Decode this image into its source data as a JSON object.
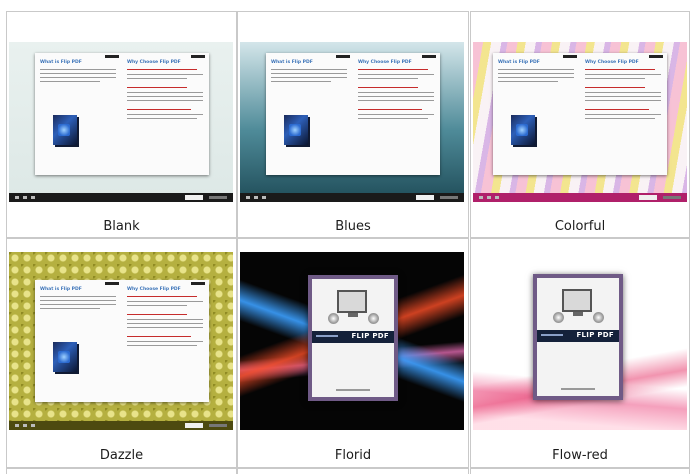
{
  "themes": [
    {
      "label": "Blank",
      "style": "book",
      "bg": "#eaf0ee"
    },
    {
      "label": "Blues",
      "style": "book",
      "bg": "#2f6a7a"
    },
    {
      "label": "Colorful",
      "style": "book",
      "bg": "#f4e3ea"
    },
    {
      "label": "Dazzle",
      "style": "book",
      "bg": "#b9b342"
    },
    {
      "label": "Florid",
      "style": "cover",
      "bg": "#080808"
    },
    {
      "label": "Flow-red",
      "style": "cover",
      "bg": "#ffffff"
    }
  ],
  "book": {
    "left_title": "What is Flip PDF",
    "right_title": "Why Choose Flip PDF"
  },
  "cover": {
    "brand": "FLIP PDF"
  }
}
